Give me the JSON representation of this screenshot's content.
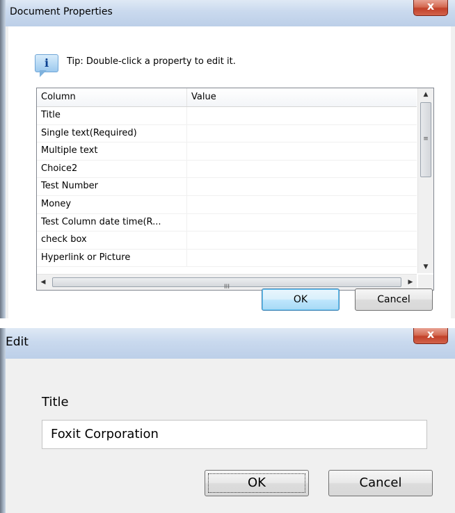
{
  "dialog1": {
    "title": "Document Properties",
    "close_glyph": "x",
    "tip_icon": "i",
    "tip_text": "Tip: Double-click a property to edit it.",
    "columns": [
      "Column",
      "Value"
    ],
    "rows": [
      {
        "column": "Title",
        "value": ""
      },
      {
        "column": "Single text(Required)",
        "value": ""
      },
      {
        "column": "Multiple text",
        "value": ""
      },
      {
        "column": "Choice2",
        "value": ""
      },
      {
        "column": "Test Number",
        "value": ""
      },
      {
        "column": "Money",
        "value": ""
      },
      {
        "column": "Test Column date time(R...",
        "value": ""
      },
      {
        "column": "check box",
        "value": ""
      },
      {
        "column": "Hyperlink or Picture",
        "value": ""
      }
    ],
    "scroll_glyphs": {
      "up": "▲",
      "down": "▼",
      "left": "◀",
      "right": "▶",
      "grip_v": "≡",
      "grip_h": "III"
    },
    "ok_label": "OK",
    "cancel_label": "Cancel"
  },
  "dialog2": {
    "title": "Edit",
    "close_glyph": "x",
    "field_label": "Title",
    "field_value": "Foxit Corporation",
    "ok_label": "OK",
    "cancel_label": "Cancel"
  }
}
